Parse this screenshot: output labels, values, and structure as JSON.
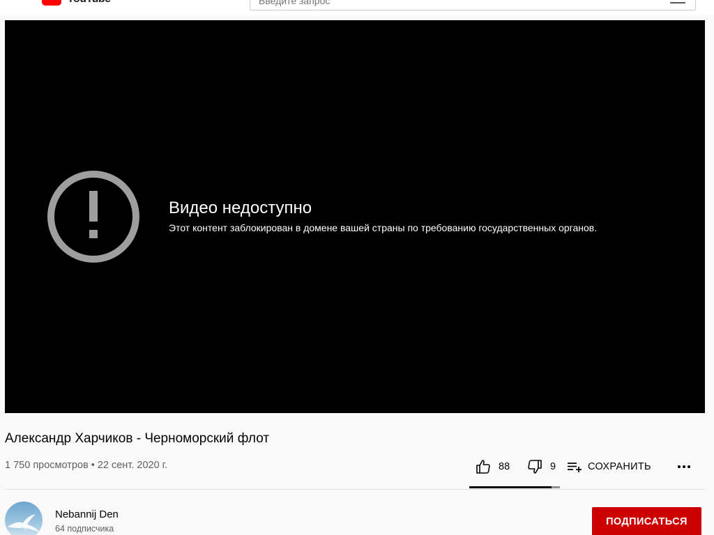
{
  "header": {
    "logo_text": "YouTube",
    "search_placeholder": "Введите запрос"
  },
  "player": {
    "error_title": "Видео недоступно",
    "error_message": "Этот контент заблокирован в домене вашей страны по требованию государственных органов."
  },
  "video": {
    "title": "Александр Харчиков - Черноморский флот",
    "views": "1 750 просмотров",
    "separator": "•",
    "date": "22 сент. 2020 г."
  },
  "actions": {
    "likes": "88",
    "dislikes": "9",
    "save_label": "СОХРАНИТЬ",
    "like_ratio": 0.907
  },
  "channel": {
    "name": "Nebannij Den",
    "subscribers": "64 подписчика",
    "subscribe_label": "ПОДПИСАТЬСЯ"
  },
  "colors": {
    "subscribe_bg": "#cc0000",
    "player_bg": "#000000",
    "warning_icon": "#9e9e9e"
  }
}
